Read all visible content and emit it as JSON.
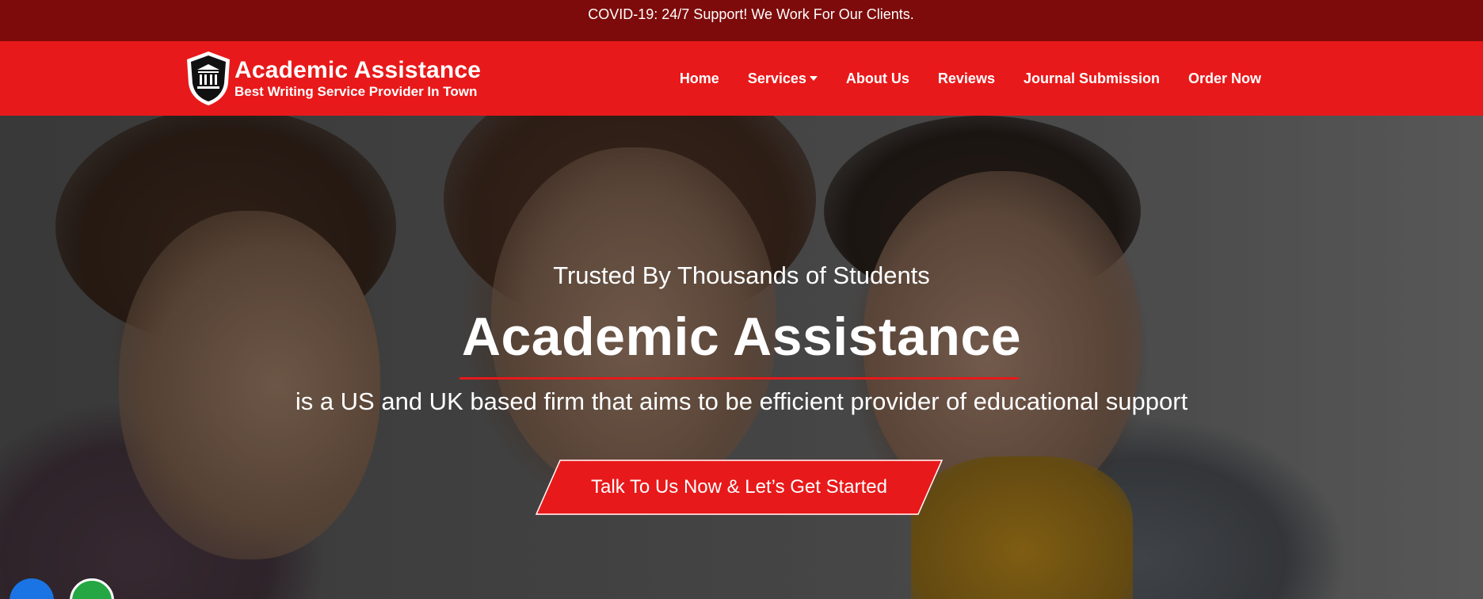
{
  "topbar": {
    "announcement": "COVID-19: 24/7 Support! We Work For Our Clients."
  },
  "brand": {
    "title": "Academic Assistance",
    "tagline": "Best Writing Service Provider In Town",
    "logo_icon": "shield-building-icon"
  },
  "nav": {
    "items": [
      {
        "label": "Home"
      },
      {
        "label": "Services",
        "has_dropdown": true
      },
      {
        "label": "About Us"
      },
      {
        "label": "Reviews"
      },
      {
        "label": "Journal Submission"
      },
      {
        "label": "Order Now"
      }
    ]
  },
  "hero": {
    "pretitle": "Trusted By Thousands of Students",
    "title": "Academic Assistance",
    "subtitle": "is a US and UK based firm that aims to be efficient provider of educational support",
    "cta_label": "Talk To Us Now & Let’s Get Started"
  },
  "floating": {
    "chat_icon": "chat-icon",
    "whatsapp_icon": "whatsapp-icon"
  },
  "colors": {
    "topbar_bg": "#7e0b0b",
    "nav_bg": "#e8191a",
    "accent": "#e8191a",
    "text": "#ffffff"
  }
}
